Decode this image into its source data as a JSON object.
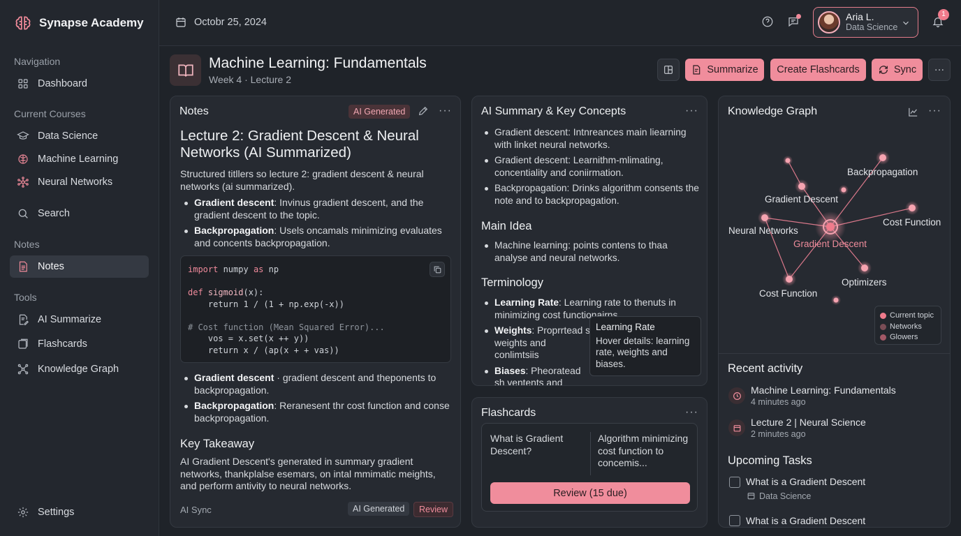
{
  "app": {
    "name": "Synapse Academy"
  },
  "sidebar": {
    "sections": {
      "navigation": "Navigation",
      "current_courses": "Current Courses",
      "notes": "Notes",
      "tools": "Tools"
    },
    "items": {
      "dashboard": "Dashboard",
      "data_science": "Data Science",
      "machine_learning": "Machine Learning",
      "neural_networks": "Neural Networks",
      "search": "Search",
      "notes": "Notes",
      "ai_summarize": "AI Summarize",
      "flashcards": "Flashcards",
      "knowledge_graph": "Knowledge Graph",
      "settings": "Settings"
    }
  },
  "header": {
    "date": "Octobr 25, 2024",
    "user": {
      "name": "Aria L.",
      "role": "Data Science"
    },
    "notification_count": "1"
  },
  "page": {
    "title": "Machine Learning: Fundamentals",
    "subtitle": "Week 4 · Lecture 2",
    "buttons": {
      "summarize": "Summarize",
      "create_flashcards": "Create Flashcards",
      "sync": "Sync"
    }
  },
  "notes_panel": {
    "title": "Notes",
    "ai_badge": "AI Generated",
    "heading": "Lecture 2: Gradient Descent & Neural Networks (AI Summarized)",
    "intro": "Structured titllers so lecture 2: gradient descent & neural networks (ai summarized).",
    "bullets_top": [
      {
        "term": "Gradient descent",
        "text": ": Invinus gradient descent, and the gradient descent to the topic."
      },
      {
        "term": "Backpropagation",
        "text": ": Usels oncamals minimizing evaluates and concents backpropagation."
      }
    ],
    "code": {
      "l1a": "import",
      "l1b": " numpy ",
      "l1c": "as",
      "l1d": " np",
      "l2a": "def",
      "l2b": " sigmoid",
      "l2c": "(x):",
      "l3": "    return 1 / (1 + np.exp(-x))",
      "l4": "# Cost function (Mean Squared Error)...",
      "l5": "    vos = x.set(x ++ y))",
      "l6": "    return x / (ap(x + + vas))"
    },
    "bullets_bottom": [
      {
        "term": "Gradient descent",
        "text": " · gradient descent and theponents to backpropagation."
      },
      {
        "term": "Backpropagation",
        "text": ": Reranesent thr cost function and conse backpropagation."
      }
    ],
    "takeaway_title": "Key Takeaway",
    "takeaway_text": "AI Gradient Descent's generated in summary gradient networks, thankplalse esemars, on intal mmimatic meights, and perform antivity to neural networks.",
    "footer_label": "AI Sync",
    "footer_chip_ai": "AI Generated",
    "footer_chip_review": "Review"
  },
  "summary_panel": {
    "title": "AI Summary & Key Concepts",
    "bullets": [
      "Gradient descent: Intnreances main liearning with linket neural networks.",
      "Gradient descent: Learnithm-mlimating, concentiality and coniirmation.",
      "Backpropagation: Drinks algorithm consents the note and to backpropagation."
    ],
    "main_idea_title": "Main Idea",
    "main_idea": "Machine learning: points contens to thaa analyse and neural networks.",
    "terminology_title": "Terminology",
    "terms": [
      {
        "term": "Learning Rate",
        "text": ": Learning rate to thenuts in minimizing cost functionairns."
      },
      {
        "term": "Weights",
        "text": ": Proprrtead s weights and conlimtsiis"
      },
      {
        "term": "Biases",
        "text": ": Pheoratead sh ventents and biases."
      }
    ],
    "tooltip": {
      "title": "Learning Rate",
      "body": "Hover details: learning rate, weights and biases."
    }
  },
  "flashcards_panel": {
    "title": "Flashcards",
    "question": "What is Gradient Descent?",
    "answer": "Algorithm minimizing cost function to concemis...",
    "review_button": "Review (15 due)"
  },
  "graph_panel": {
    "title": "Knowledge Graph",
    "labels": {
      "backprop": "Backpropagation",
      "gd_top": "Gradient Descent",
      "cost_right": "Cost Function",
      "neural": "Neural Networks",
      "gd_center": "Gradient Descent",
      "optimizers": "Optimizers",
      "cost_bottom": "Cost Function"
    },
    "legend": [
      "Current topic",
      "Networks",
      "Glowers"
    ],
    "colors": {
      "accent": "#f08d9c",
      "node": "#f5a3b0",
      "edge": "#d9788a"
    }
  },
  "activity": {
    "title": "Recent activity",
    "items": [
      {
        "title": "Machine Learning: Fundamentals",
        "time": "4 minutes ago"
      },
      {
        "title": "Lecture 2 | Neural Science",
        "time": "2 minutes ago"
      }
    ]
  },
  "tasks": {
    "title": "Upcoming Tasks",
    "items": [
      {
        "title": "What is a Gradient Descent",
        "course": "Data Science"
      },
      {
        "title": "What is a Gradient Descent"
      }
    ]
  }
}
